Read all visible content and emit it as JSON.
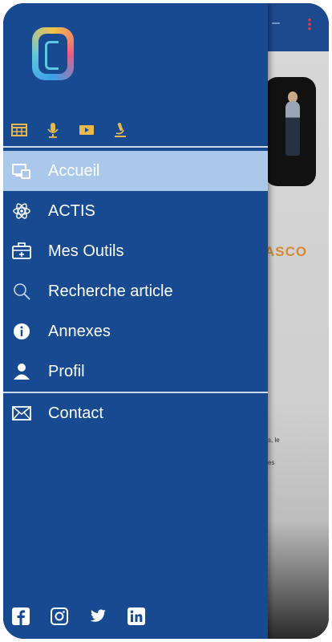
{
  "app_bg": {
    "banner_text": "ASCO",
    "snippet_1": "s, le",
    "snippet_2": "es"
  },
  "drawer": {
    "top_icons": [
      "table-icon",
      "microphone-icon",
      "video-icon",
      "microscope-icon"
    ],
    "menu": [
      {
        "label": "Accueil",
        "icon": "home-devices-icon",
        "active": true
      },
      {
        "label": "ACTIS",
        "icon": "atom-icon",
        "active": false
      },
      {
        "label": "Mes Outils",
        "icon": "toolbox-icon",
        "active": false
      },
      {
        "label": "Recherche article",
        "icon": "search-icon",
        "active": false
      },
      {
        "label": "Annexes",
        "icon": "info-icon",
        "active": false
      },
      {
        "label": "Profil",
        "icon": "user-icon",
        "active": false
      },
      {
        "label": "Contact",
        "icon": "envelope-icon",
        "active": false
      }
    ],
    "socials": [
      "facebook-icon",
      "instagram-icon",
      "twitter-icon",
      "linkedin-icon"
    ]
  },
  "colors": {
    "drawer_bg": "#184a91",
    "active_bg": "#a9c8ea",
    "accent_orange": "#d28a35",
    "icon_gold": "#e8b84a"
  }
}
